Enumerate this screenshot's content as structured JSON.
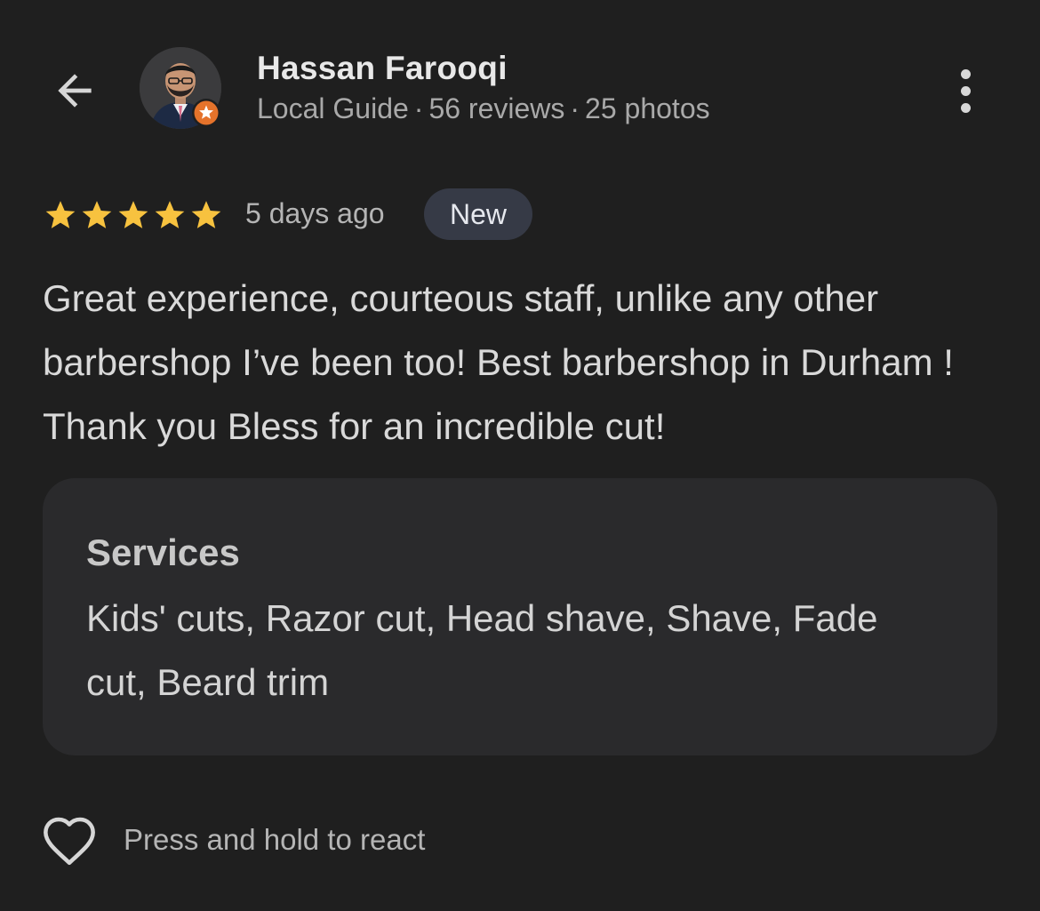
{
  "header": {
    "back_icon": "arrow-left-icon",
    "reviewer_name": "Hassan Farooqi",
    "reviewer_level": "Local Guide",
    "reviews_count": "56 reviews",
    "photos_count": "25 photos",
    "separator": "·",
    "more_icon": "more-vert-icon",
    "badge_icon": "local-guide-star-icon",
    "badge_color": "#e5732b"
  },
  "review": {
    "rating": 5,
    "star_color": "#f7c23f",
    "time_ago": "5 days ago",
    "new_badge": "New",
    "text": "Great experience, courteous staff, unlike any other barbershop I’ve been too! Best barbershop in Durham ! Thank you Bless for an incredible cut!"
  },
  "services": {
    "title": "Services",
    "list": "Kids' cuts, Razor cut, Head shave, Shave, Fade cut, Beard trim"
  },
  "reaction": {
    "icon": "heart-outline-icon",
    "label": "Press and hold to react"
  }
}
